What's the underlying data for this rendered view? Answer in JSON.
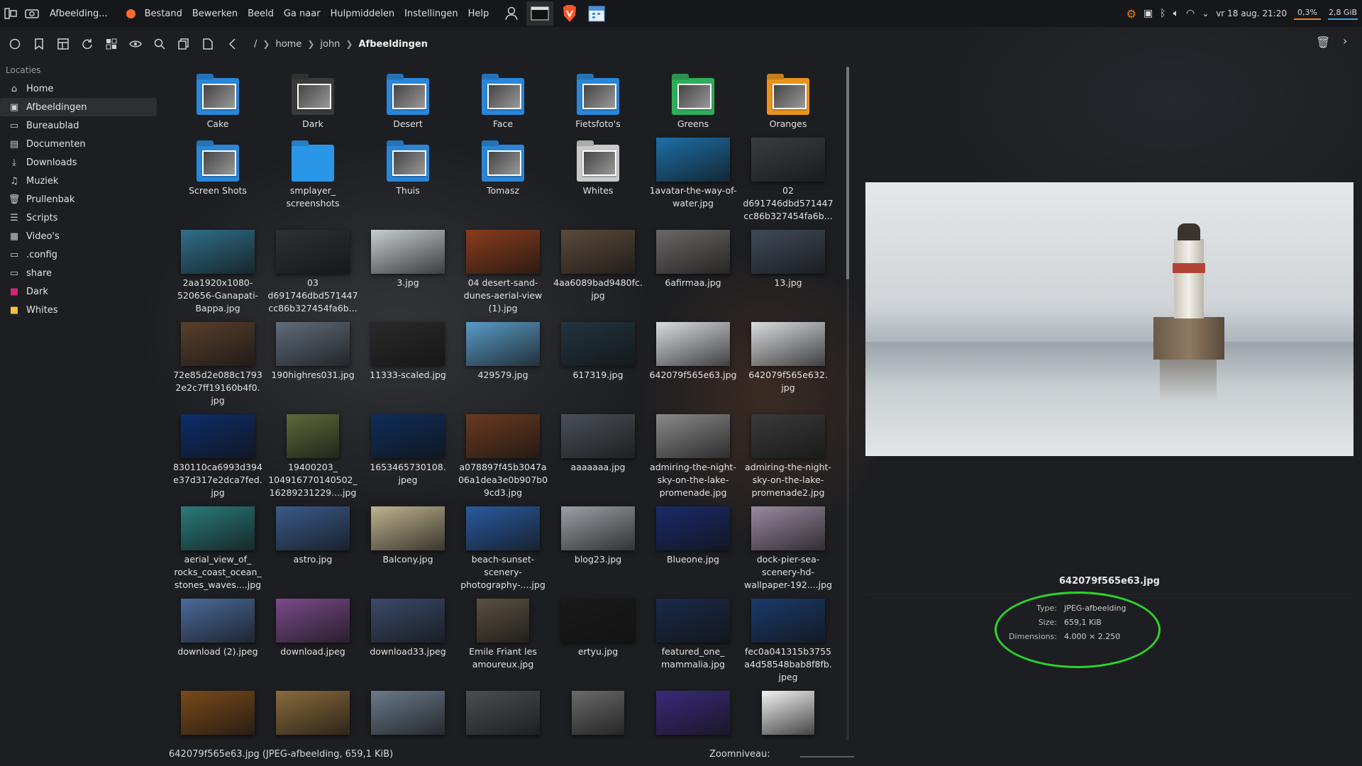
{
  "topbar": {
    "app_title": "Afbeelding...",
    "menu": [
      "Bestand",
      "Bewerken",
      "Beeld",
      "Ga naar",
      "Hulpmiddelen",
      "Instellingen",
      "Help"
    ],
    "clock": "vr 18 aug. 21:20",
    "cpu": "0,3%",
    "memory": "2,8 GiB"
  },
  "breadcrumb": {
    "root": "/",
    "parts": [
      "home",
      "john"
    ],
    "current": "Afbeeldingen"
  },
  "sidebar": {
    "header": "Locaties",
    "items": [
      {
        "label": "Home",
        "icon": "home-icon"
      },
      {
        "label": "Afbeeldingen",
        "icon": "pictures-icon"
      },
      {
        "label": "Bureaublad",
        "icon": "desktop-icon"
      },
      {
        "label": "Documenten",
        "icon": "document-icon"
      },
      {
        "label": "Downloads",
        "icon": "download-icon"
      },
      {
        "label": "Muziek",
        "icon": "music-icon"
      },
      {
        "label": "Prullenbak",
        "icon": "trash-icon"
      },
      {
        "label": "Scripts",
        "icon": "scripts-icon"
      },
      {
        "label": "Video's",
        "icon": "video-icon"
      },
      {
        "label": ".config",
        "icon": "folder-icon"
      },
      {
        "label": "share",
        "icon": "folder-icon"
      },
      {
        "label": "Dark",
        "icon": "folder-pink-icon"
      },
      {
        "label": "Whites",
        "icon": "folder-yellow-icon"
      }
    ]
  },
  "files": [
    {
      "name": "Cake",
      "kind": "folder",
      "color": "#2a86d8"
    },
    {
      "name": "Dark",
      "kind": "folder",
      "color": "#3a3a3a"
    },
    {
      "name": "Desert",
      "kind": "folder",
      "color": "#2a86d8"
    },
    {
      "name": "Face",
      "kind": "folder",
      "color": "#2a86d8"
    },
    {
      "name": "Fietsfoto's",
      "kind": "folder",
      "color": "#2a86d8"
    },
    {
      "name": "Greens",
      "kind": "folder",
      "color": "#2fae5a"
    },
    {
      "name": "Oranges",
      "kind": "folder",
      "color": "#e8941c"
    },
    {
      "name": "Screen Shots",
      "kind": "folder",
      "color": "#2a86d8"
    },
    {
      "name": "smplayer_\nscreenshots",
      "kind": "folder-plain",
      "color": "#2a96e8"
    },
    {
      "name": "Thuis",
      "kind": "folder",
      "color": "#2a86d8"
    },
    {
      "name": "Tomasz",
      "kind": "folder",
      "color": "#2a86d8"
    },
    {
      "name": "Whites",
      "kind": "folder",
      "color": "#c9c9c9"
    },
    {
      "name": "1avatar-the-way-of-\nwater.jpg",
      "kind": "image",
      "color": "#1d6fa8"
    },
    {
      "name": "02\nd691746dbd571447\ncc86b327454fa6b...",
      "kind": "image",
      "color": "#3a3d40"
    },
    {
      "name": "2aa1920x1080-\n520656-Ganapati-\nBappa.jpg",
      "kind": "image",
      "color": "#2f6f8a"
    },
    {
      "name": "03\nd691746dbd571447\ncc86b327454fa6b...",
      "kind": "image",
      "color": "#2e3033"
    },
    {
      "name": "3.jpg",
      "kind": "image",
      "color": "#c7cdd2"
    },
    {
      "name": "04 desert-sand-\ndunes-aerial-view\n(1).jpg",
      "kind": "image",
      "color": "#8a3c1c"
    },
    {
      "name": "4aa6089bad9480fc.\njpg",
      "kind": "image",
      "color": "#5b4a3a"
    },
    {
      "name": "6afirmaa.jpg",
      "kind": "image",
      "color": "#6a6866"
    },
    {
      "name": "13.jpg",
      "kind": "image",
      "color": "#3f4a58"
    },
    {
      "name": "72e85d2e088c1793\n2e2c7ff19160b4f0.\njpg",
      "kind": "image",
      "color": "#5a3f2c"
    },
    {
      "name": "190highres031.jpg",
      "kind": "image",
      "color": "#5f6c7a"
    },
    {
      "name": "11333-scaled.jpg",
      "kind": "image",
      "color": "#2a2a2a"
    },
    {
      "name": "429579.jpg",
      "kind": "image",
      "color": "#5a9ac6"
    },
    {
      "name": "617319.jpg",
      "kind": "image",
      "color": "#223440"
    },
    {
      "name": "642079f565e63.jpg",
      "kind": "image",
      "color": "#d9dcdf"
    },
    {
      "name": "642079f565e632.\njpg",
      "kind": "image",
      "color": "#d9dcdf"
    },
    {
      "name": "830110ca6993d394\ne37d317e2dca7fed.\njpg",
      "kind": "image",
      "color": "#0e2d6a"
    },
    {
      "name": "19400203_\n104916770140502_\n16289231229....jpg",
      "kind": "portrait",
      "color": "#5c6a3a"
    },
    {
      "name": "1653465730108.\njpeg",
      "kind": "image",
      "color": "#0f2d5a"
    },
    {
      "name": "a078897f45b3047a\n06a1dea3e0b907b0\n9cd3.jpg",
      "kind": "image",
      "color": "#6a3a20"
    },
    {
      "name": "aaaaaaa.jpg",
      "kind": "image",
      "color": "#4a5058"
    },
    {
      "name": "admiring-the-night-\nsky-on-the-lake-\npromenade.jpg",
      "kind": "image",
      "color": "#8a8a8a"
    },
    {
      "name": "admiring-the-night-\nsky-on-the-lake-\npromenade2.jpg",
      "kind": "image",
      "color": "#3a3a3a"
    },
    {
      "name": "aerial_view_of_\nrocks_coast_ocean_\nstones_waves....jpg",
      "kind": "image",
      "color": "#2a7a7a"
    },
    {
      "name": "astro.jpg",
      "kind": "image",
      "color": "#3a5a8a"
    },
    {
      "name": "Balcony.jpg",
      "kind": "image",
      "color": "#bfb38f"
    },
    {
      "name": "beach-sunset-\nscenery-\nphotography-....jpg",
      "kind": "image",
      "color": "#2a5aa0"
    },
    {
      "name": "blog23.jpg",
      "kind": "image",
      "color": "#9aa0a6"
    },
    {
      "name": "Blueone.jpg",
      "kind": "image",
      "color": "#1a2a6a"
    },
    {
      "name": "dock-pier-sea-\nscenery-hd-\nwallpaper-192....jpg",
      "kind": "image",
      "color": "#9a8aa0"
    },
    {
      "name": "download (2).jpeg",
      "kind": "image",
      "color": "#4a6a9a"
    },
    {
      "name": "download.jpeg",
      "kind": "image",
      "color": "#7a4a8a"
    },
    {
      "name": "download33.jpeg",
      "kind": "image",
      "color": "#3a4a6a"
    },
    {
      "name": "Emile Friant les\namoureux.jpg",
      "kind": "portrait",
      "color": "#5a5040"
    },
    {
      "name": "ertyu.jpg",
      "kind": "image",
      "color": "#1a1a1a"
    },
    {
      "name": "featured_one_\nmammalia.jpg",
      "kind": "image",
      "color": "#1a2a4a"
    },
    {
      "name": "fec0a041315b3755\na4d58548bab8f8fb.\njpeg",
      "kind": "image",
      "color": "#1a3a6a"
    },
    {
      "name": "",
      "kind": "image",
      "color": "#7a4a1a"
    },
    {
      "name": "",
      "kind": "image",
      "color": "#8a6a3a"
    },
    {
      "name": "",
      "kind": "image",
      "color": "#6a7a8a"
    },
    {
      "name": "",
      "kind": "image",
      "color": "#4a4e52"
    },
    {
      "name": "",
      "kind": "portrait",
      "color": "#6a6a6a"
    },
    {
      "name": "",
      "kind": "image",
      "color": "#3a2a7a"
    },
    {
      "name": "",
      "kind": "portrait",
      "color": "#f2f2f2"
    }
  ],
  "preview": {
    "filename": "642079f565e63.jpg",
    "type_label": "Type:",
    "type_value": "JPEG-afbeelding",
    "size_label": "Size:",
    "size_value": "659,1 KiB",
    "dim_label": "Dimensions:",
    "dim_value": "4.000 × 2.250"
  },
  "status": {
    "message": "642079f565e63.jpg (JPEG-afbeelding, 659,1 KiB)",
    "zoom_label": "Zoomniveau:"
  },
  "colors": {
    "highlight_ring": "#2bd52b",
    "accent_orange": "#ff6b2b"
  }
}
